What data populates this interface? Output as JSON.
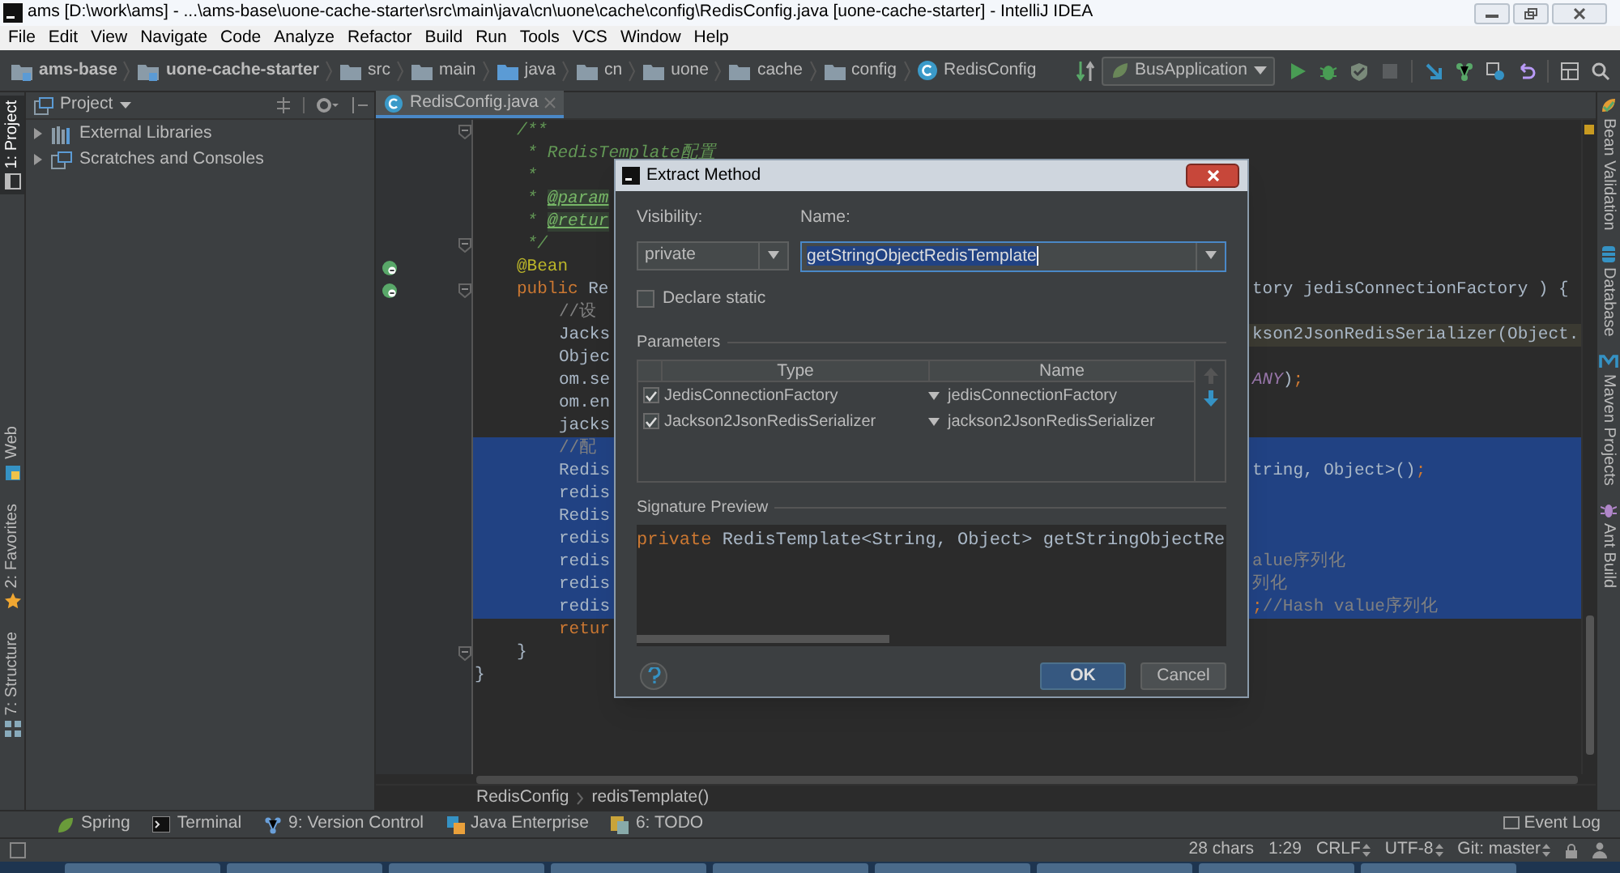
{
  "window": {
    "title": "ams [D:\\work\\ams] - ...\\ams-base\\uone-cache-starter\\src\\main\\java\\cn\\uone\\cache\\config\\RedisConfig.java [uone-cache-starter] - IntelliJ IDEA"
  },
  "menu": [
    "File",
    "Edit",
    "View",
    "Navigate",
    "Code",
    "Analyze",
    "Refactor",
    "Build",
    "Run",
    "Tools",
    "VCS",
    "Window",
    "Help"
  ],
  "navigation_bar": {
    "breadcrumbs": [
      {
        "label": "ams-base",
        "kind": "module"
      },
      {
        "label": "uone-cache-starter",
        "kind": "module"
      },
      {
        "label": "src",
        "kind": "folder"
      },
      {
        "label": "main",
        "kind": "folder"
      },
      {
        "label": "java",
        "kind": "source"
      },
      {
        "label": "cn",
        "kind": "folder"
      },
      {
        "label": "uone",
        "kind": "folder"
      },
      {
        "label": "cache",
        "kind": "folder"
      },
      {
        "label": "config",
        "kind": "folder"
      },
      {
        "label": "RedisConfig",
        "kind": "class"
      }
    ],
    "run_configuration": "BusApplication"
  },
  "left_stripe": [
    {
      "label": "1: Project",
      "kind": "project",
      "selected": true
    },
    {
      "label": "Web",
      "kind": "web",
      "selected": false
    },
    {
      "label": "2: Favorites",
      "kind": "favorites",
      "selected": false
    },
    {
      "label": "7: Structure",
      "kind": "structure",
      "selected": false
    }
  ],
  "project_panel": {
    "title": "Project",
    "items": [
      {
        "label": "External Libraries",
        "kind": "libraries",
        "expanded": false
      },
      {
        "label": "Scratches and Consoles",
        "kind": "scratches",
        "expanded": false
      }
    ]
  },
  "editor": {
    "tabs": [
      {
        "label": "RedisConfig.java",
        "selected": true
      }
    ],
    "lines": [
      {
        "kind": "member",
        "fold_marker": true,
        "bean_icon": false,
        "selected": false,
        "highlighted": false,
        "left": [
          {
            "text": "/**",
            "kind": "doc"
          }
        ]
      },
      {
        "kind": "member",
        "fold_marker": false,
        "bean_icon": false,
        "selected": false,
        "highlighted": false,
        "left": [
          {
            "text": " * RedisTemplate配置",
            "kind": "doc"
          }
        ]
      },
      {
        "kind": "member",
        "fold_marker": false,
        "bean_icon": false,
        "selected": false,
        "highlighted": false,
        "left": [
          {
            "text": " *",
            "kind": "doc"
          }
        ]
      },
      {
        "kind": "member",
        "fold_marker": false,
        "bean_icon": false,
        "selected": false,
        "highlighted": false,
        "left": [
          {
            "text": " * ",
            "kind": "doc"
          },
          {
            "text": "@param",
            "kind": "tag"
          }
        ]
      },
      {
        "kind": "member",
        "fold_marker": false,
        "bean_icon": false,
        "selected": false,
        "highlighted": false,
        "left": [
          {
            "text": " * ",
            "kind": "doc"
          },
          {
            "text": "@retur",
            "kind": "tag"
          }
        ]
      },
      {
        "kind": "member",
        "fold_marker": true,
        "bean_icon": false,
        "selected": false,
        "highlighted": false,
        "left": [
          {
            "text": " */",
            "kind": "doc"
          }
        ]
      },
      {
        "kind": "member",
        "fold_marker": false,
        "bean_icon": true,
        "selected": false,
        "highlighted": false,
        "left": [
          {
            "text": "@Bean",
            "kind": "annotation"
          }
        ]
      },
      {
        "kind": "member",
        "fold_marker": true,
        "bean_icon": true,
        "selected": false,
        "highlighted": false,
        "left": [
          {
            "text": "public ",
            "kind": "keyword"
          },
          {
            "text": "Re",
            "kind": "plain"
          }
        ],
        "right": [
          {
            "text": "tory jedisConnectionFactory ) {",
            "kind": "plain"
          }
        ]
      },
      {
        "kind": "body",
        "fold_marker": false,
        "bean_icon": false,
        "selected": false,
        "highlighted": false,
        "left": [
          {
            "text": "//设",
            "kind": "comment"
          }
        ]
      },
      {
        "kind": "body",
        "fold_marker": false,
        "bean_icon": false,
        "selected": false,
        "highlighted": true,
        "left": [
          {
            "text": "Jacks",
            "kind": "plain"
          }
        ],
        "right": [
          {
            "text": "kson2JsonRedisSerializer(Object.",
            "kind": "plain"
          }
        ]
      },
      {
        "kind": "body",
        "fold_marker": false,
        "bean_icon": false,
        "selected": false,
        "highlighted": false,
        "left": [
          {
            "text": "Objec",
            "kind": "plain"
          }
        ]
      },
      {
        "kind": "body",
        "fold_marker": false,
        "bean_icon": false,
        "selected": false,
        "highlighted": false,
        "left": [
          {
            "text": "om.se",
            "kind": "plain"
          }
        ],
        "right": [
          {
            "text": "ANY",
            "kind": "constant"
          },
          {
            "text": ")",
            "kind": "plain"
          },
          {
            "text": ";",
            "kind": "keyword"
          }
        ]
      },
      {
        "kind": "body",
        "fold_marker": false,
        "bean_icon": false,
        "selected": false,
        "highlighted": false,
        "left": [
          {
            "text": "om.en",
            "kind": "plain"
          }
        ]
      },
      {
        "kind": "body",
        "fold_marker": false,
        "bean_icon": false,
        "selected": false,
        "highlighted": false,
        "left": [
          {
            "text": "jacks",
            "kind": "plain"
          }
        ]
      },
      {
        "kind": "body",
        "fold_marker": false,
        "bean_icon": false,
        "selected": true,
        "highlighted": false,
        "left": [
          {
            "text": "//配",
            "kind": "comment"
          }
        ]
      },
      {
        "kind": "body",
        "fold_marker": false,
        "bean_icon": false,
        "selected": true,
        "highlighted": false,
        "left": [
          {
            "text": "Redis",
            "kind": "plain"
          }
        ],
        "right": [
          {
            "text": "tring, Object>()",
            "kind": "plain"
          },
          {
            "text": ";",
            "kind": "keyword"
          }
        ]
      },
      {
        "kind": "body",
        "fold_marker": false,
        "bean_icon": false,
        "selected": true,
        "highlighted": false,
        "left": [
          {
            "text": "redis",
            "kind": "plain"
          }
        ]
      },
      {
        "kind": "body",
        "fold_marker": false,
        "bean_icon": false,
        "selected": true,
        "highlighted": false,
        "left": [
          {
            "text": "Redis",
            "kind": "plain"
          }
        ]
      },
      {
        "kind": "body",
        "fold_marker": false,
        "bean_icon": false,
        "selected": true,
        "highlighted": false,
        "left": [
          {
            "text": "redis",
            "kind": "plain"
          }
        ]
      },
      {
        "kind": "body",
        "fold_marker": false,
        "bean_icon": false,
        "selected": true,
        "highlighted": false,
        "left": [
          {
            "text": "redis",
            "kind": "plain"
          }
        ],
        "right": [
          {
            "text": "alue序列化",
            "kind": "comment"
          }
        ]
      },
      {
        "kind": "body",
        "fold_marker": false,
        "bean_icon": false,
        "selected": true,
        "highlighted": false,
        "left": [
          {
            "text": "redis",
            "kind": "plain"
          }
        ],
        "right": [
          {
            "text": "列化",
            "kind": "comment"
          }
        ]
      },
      {
        "kind": "body",
        "fold_marker": false,
        "bean_icon": false,
        "selected": true,
        "highlighted": false,
        "left": [
          {
            "text": "redis",
            "kind": "plain"
          }
        ],
        "right": [
          {
            "text": ";",
            "kind": "keyword"
          },
          {
            "text": "//Hash value序列化",
            "kind": "comment"
          }
        ]
      },
      {
        "kind": "body",
        "fold_marker": false,
        "bean_icon": false,
        "selected": false,
        "highlighted": false,
        "left": [
          {
            "text": "retur",
            "kind": "keyword"
          }
        ]
      },
      {
        "kind": "member",
        "fold_marker": true,
        "bean_icon": false,
        "selected": false,
        "highlighted": false,
        "left": [
          {
            "text": "}",
            "kind": "plain"
          }
        ]
      },
      {
        "kind": "top",
        "fold_marker": false,
        "bean_icon": false,
        "selected": false,
        "highlighted": false,
        "left": [
          {
            "text": "}",
            "kind": "plain"
          }
        ]
      }
    ],
    "breadcrumbs": [
      "RedisConfig",
      "redisTemplate()"
    ]
  },
  "right_stripe": [
    {
      "label": "Bean Validation",
      "kind": "bean"
    },
    {
      "label": "Database",
      "kind": "database"
    },
    {
      "label": "Maven Projects",
      "kind": "maven"
    },
    {
      "label": "Ant Build",
      "kind": "ant"
    }
  ],
  "dialog": {
    "title": "Extract Method",
    "visibility_label": "Visibility:",
    "visibility": "private",
    "name_label": "Name:",
    "name": "getStringObjectRedisTemplate",
    "declare_static": {
      "label": "Declare static",
      "checked": false
    },
    "parameters_label": "Parameters",
    "parameter_columns": [
      "Type",
      "Name"
    ],
    "parameters": [
      {
        "checked": true,
        "type": "JedisConnectionFactory",
        "name": "jedisConnectionFactory"
      },
      {
        "checked": true,
        "type": "Jackson2JsonRedisSerializer",
        "name": "jackson2JsonRedisSerializer"
      }
    ],
    "move_up": {
      "disabled": true
    },
    "move_down": {
      "disabled": false
    },
    "preview_label": "Signature Preview",
    "preview": [
      {
        "text": "private ",
        "kind": "keyword"
      },
      {
        "text": "RedisTemplate<String, Object> getStringObjectRe",
        "kind": "plain"
      }
    ],
    "buttons": [
      {
        "label": "OK",
        "kind": "primary"
      },
      {
        "label": "Cancel",
        "kind": "secondary"
      }
    ]
  },
  "tool_windows": [
    {
      "label": "Spring",
      "kind": "spring"
    },
    {
      "label": "Terminal",
      "kind": "terminal"
    },
    {
      "label": "9: Version Control",
      "kind": "vcs"
    },
    {
      "label": "Java Enterprise",
      "kind": "javaee"
    },
    {
      "label": "6: TODO",
      "kind": "todo"
    }
  ],
  "event_log": "Event Log",
  "status_bar": [
    {
      "text": "28 chars",
      "kind": "plain"
    },
    {
      "text": "1:29",
      "kind": "plain"
    },
    {
      "text": "CRLF",
      "kind": "switch"
    },
    {
      "text": "UTF-8",
      "kind": "switch"
    },
    {
      "text": "Git: master",
      "kind": "switch"
    }
  ]
}
